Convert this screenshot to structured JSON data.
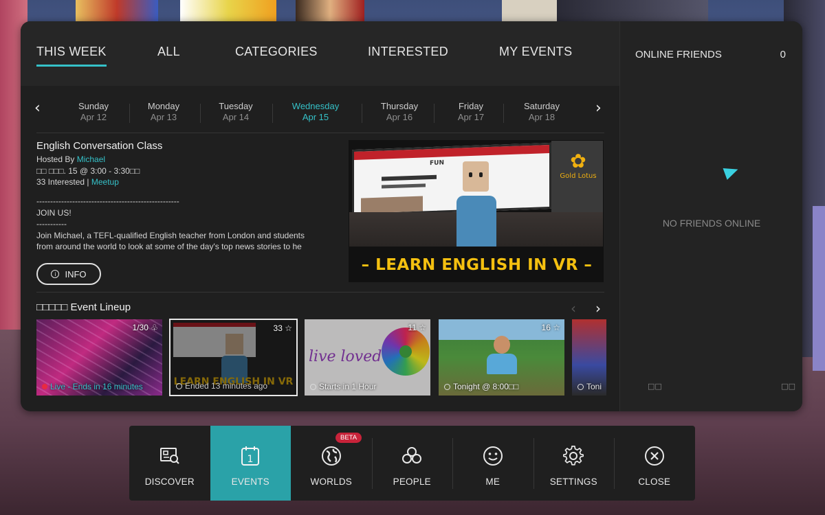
{
  "tabs": [
    {
      "label": "THIS WEEK"
    },
    {
      "label": "ALL"
    },
    {
      "label": "CATEGORIES"
    },
    {
      "label": "INTERESTED"
    },
    {
      "label": "MY EVENTS"
    }
  ],
  "friends": {
    "title": "ONLINE FRIENDS",
    "count": "0",
    "empty_text": "NO FRIENDS ONLINE",
    "glyph_left": "□□",
    "glyph_right": "□□"
  },
  "days": [
    {
      "name": "Sunday",
      "date": "Apr 12"
    },
    {
      "name": "Monday",
      "date": "Apr 13"
    },
    {
      "name": "Tuesday",
      "date": "Apr 14"
    },
    {
      "name": "Wednesday",
      "date": "Apr 15"
    },
    {
      "name": "Thursday",
      "date": "Apr 16"
    },
    {
      "name": "Friday",
      "date": "Apr 17"
    },
    {
      "name": "Saturday",
      "date": "Apr 18"
    }
  ],
  "event": {
    "title": "English Conversation Class",
    "hosted_by_label": "Hosted By ",
    "host": "Michael",
    "time": "□□ □□□. 15 @ 3:00 - 3:30□□",
    "interested": "33 Interested",
    "separator": " | ",
    "tag": "Meetup",
    "description": [
      "----------------------------------------------------",
      "JOIN US!",
      "-----------",
      "Join Michael, a TEFL-qualified English teacher from London and students",
      "from around the world to look at some of the day's top news stories to he"
    ],
    "info_button": "INFO",
    "hero": {
      "caption": "– LEARN ENGLISH IN VR –",
      "brand": "Gold Lotus",
      "screen_tag": "FUN"
    }
  },
  "lineup": {
    "title": "□□□□□ Event Lineup",
    "cards": [
      {
        "count": "1/30",
        "status": "Live - Ends in 16 minutes"
      },
      {
        "count": "33",
        "status": "Ended 13 minutes ago",
        "caption": "LEARN ENGLISH IN VR"
      },
      {
        "count": "11",
        "status": "Starts in 1 Hour",
        "script": "live loved"
      },
      {
        "count": "16",
        "status": "Tonight @ 8:00□□"
      },
      {
        "count": "",
        "status": "Toni"
      }
    ]
  },
  "nav": [
    {
      "label": "DISCOVER",
      "icon": "discover-icon"
    },
    {
      "label": "EVENTS",
      "icon": "calendar-icon",
      "active": true
    },
    {
      "label": "WORLDS",
      "icon": "globe-icon",
      "badge": "BETA"
    },
    {
      "label": "PEOPLE",
      "icon": "people-icon"
    },
    {
      "label": "ME",
      "icon": "smiley-icon"
    },
    {
      "label": "SETTINGS",
      "icon": "gear-icon"
    },
    {
      "label": "CLOSE",
      "icon": "close-icon"
    }
  ],
  "colors": {
    "accent": "#35c1c8",
    "nav_active": "#2aa2a8",
    "beta": "#c8233a",
    "caption_yellow": "#f4c010"
  }
}
